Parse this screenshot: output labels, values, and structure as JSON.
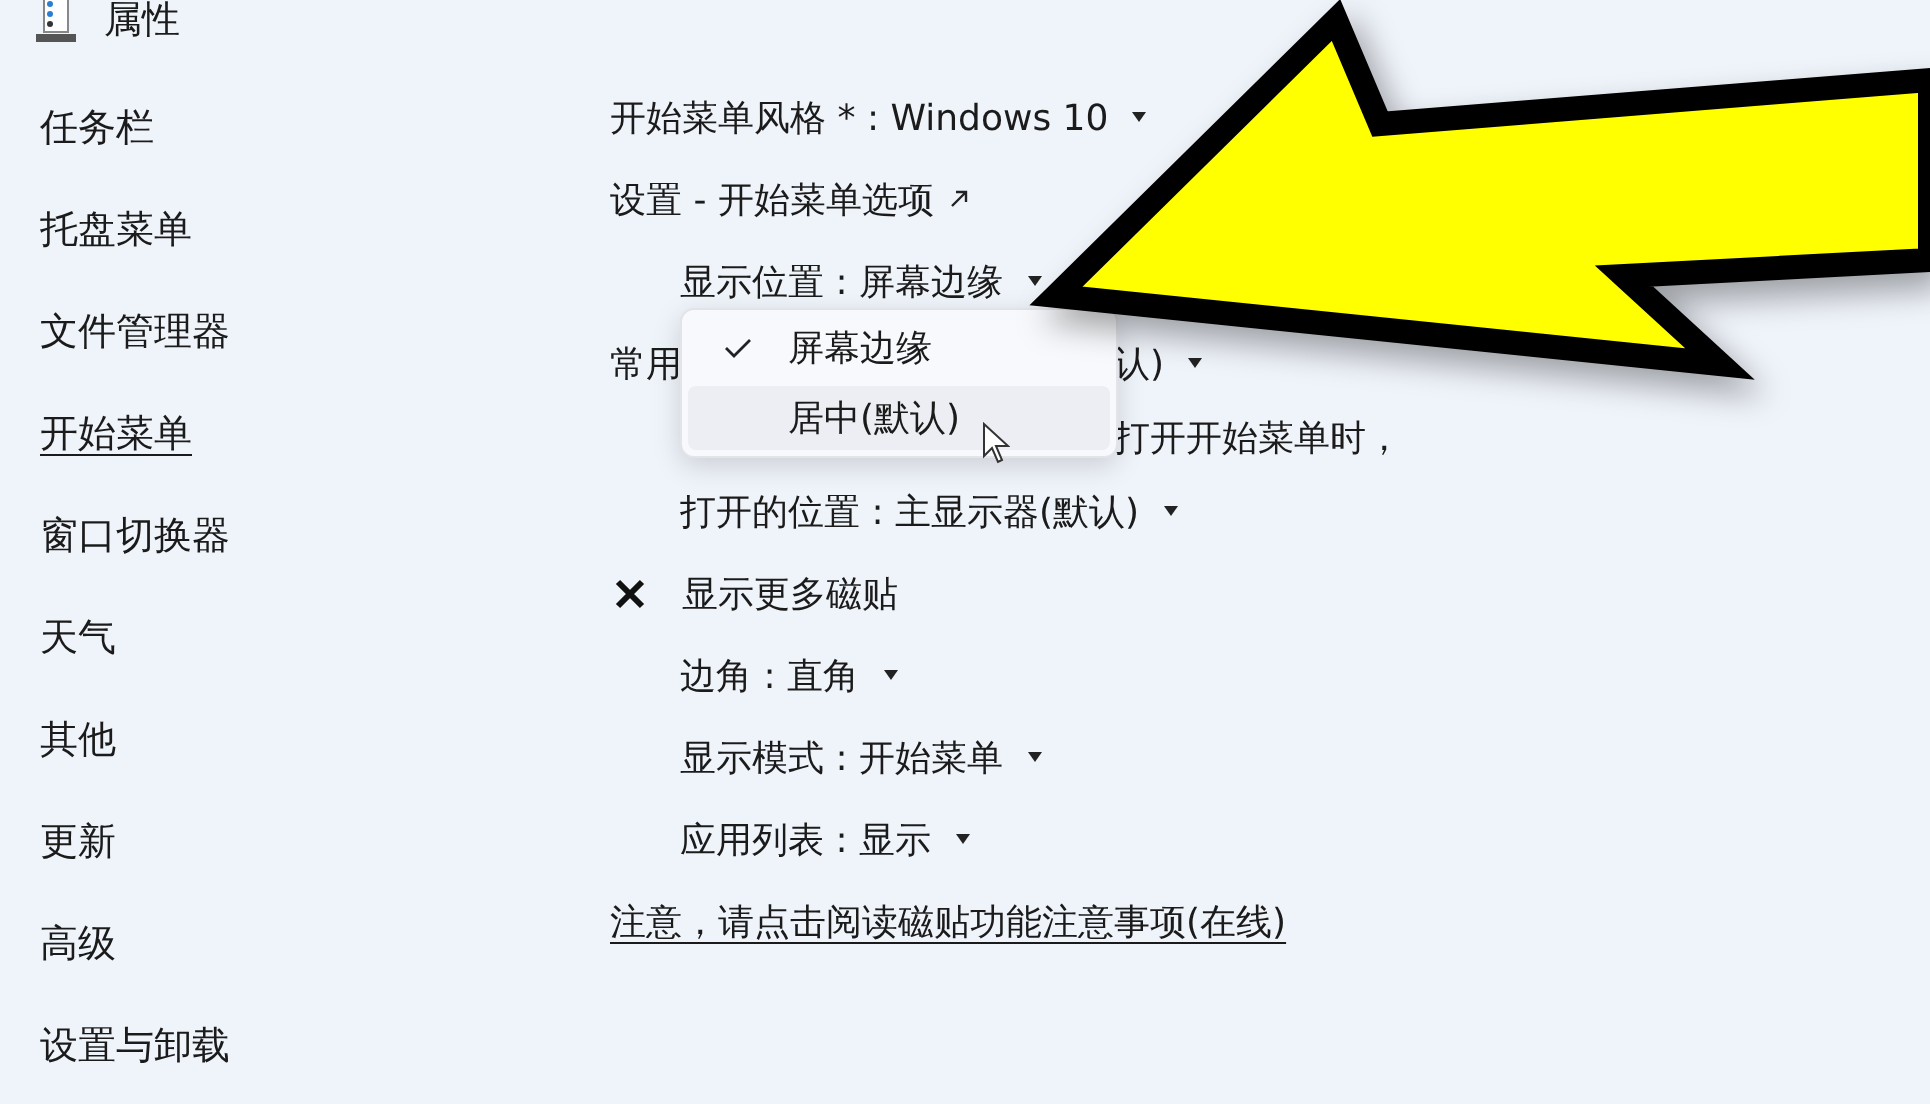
{
  "header": {
    "title": "属性"
  },
  "sidebar": {
    "items": [
      {
        "label": "任务栏",
        "selected": false
      },
      {
        "label": "托盘菜单",
        "selected": false
      },
      {
        "label": "文件管理器",
        "selected": false
      },
      {
        "label": "开始菜单",
        "selected": true
      },
      {
        "label": "窗口切换器",
        "selected": false
      },
      {
        "label": "天气",
        "selected": false
      },
      {
        "label": "其他",
        "selected": false
      },
      {
        "label": "更新",
        "selected": false
      },
      {
        "label": "高级",
        "selected": false
      },
      {
        "label": "设置与卸载",
        "selected": false
      }
    ]
  },
  "settings": [
    {
      "kind": "dropdown",
      "text": "开始菜单风格 * : Windows 10"
    },
    {
      "kind": "link",
      "text": "设置 - 开始菜单选项",
      "children": [
        {
          "kind": "dropdown",
          "text": "显示位置 : 屏幕边缘",
          "menu": [
            {
              "label": "屏幕边缘",
              "selected": true,
              "highlighted": false
            },
            {
              "label": "居中(默认)",
              "selected": false,
              "highlighted": true
            }
          ]
        }
      ]
    },
    {
      "kind": "dropdown",
      "text": "常用",
      "text_end": "认)",
      "children": [
        {
          "kind": "text",
          "text_end": "打开开始菜单时，"
        },
        {
          "kind": "dropdown",
          "text": "打开的位置 : 主显示器(默认)"
        }
      ]
    },
    {
      "kind": "toggle",
      "text": "显示更多磁贴",
      "on": false,
      "children": [
        {
          "kind": "dropdown",
          "text": "边角 : 直角"
        },
        {
          "kind": "dropdown",
          "text": "显示模式 : 开始菜单"
        },
        {
          "kind": "dropdown",
          "text": "应用列表 : 显示"
        }
      ]
    },
    {
      "kind": "note",
      "text": "注意，请点击阅读磁贴功能注意事项(在线)"
    }
  ]
}
